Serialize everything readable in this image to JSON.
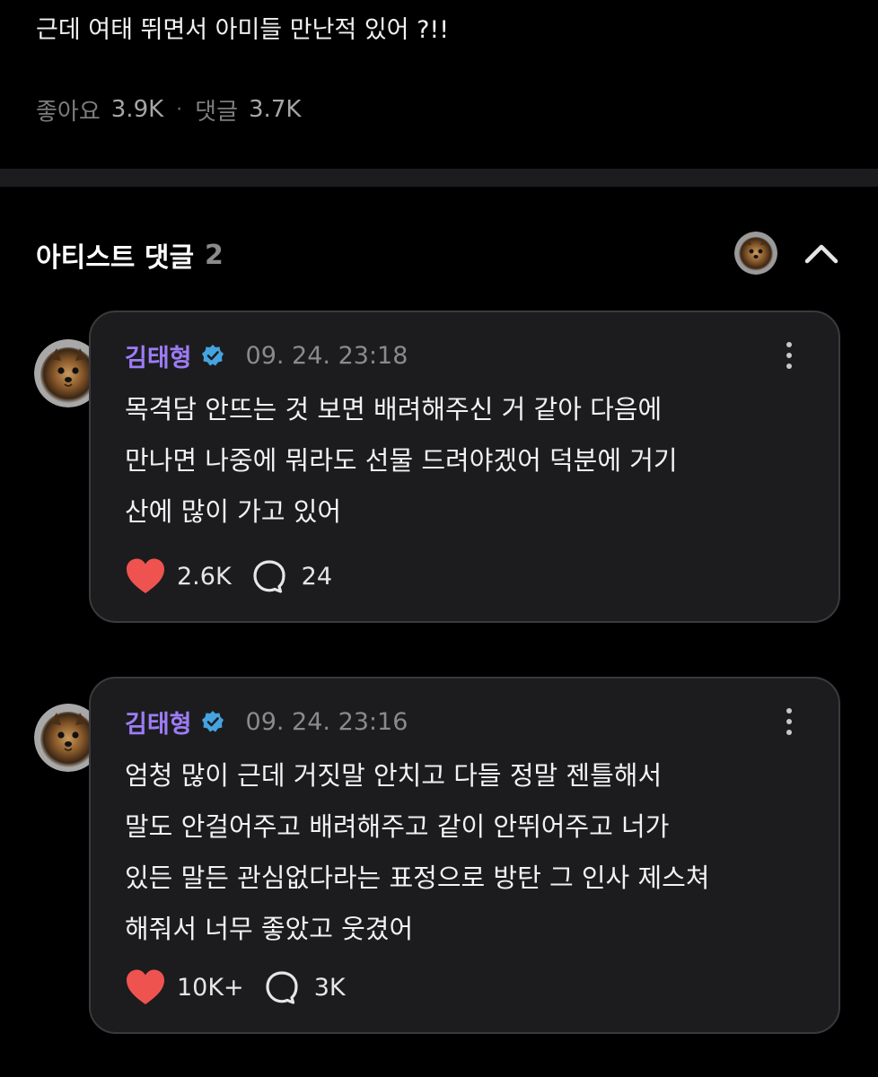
{
  "post": {
    "text": "근데 여태 뛰면서 아미들 만난적 있어 ?!!",
    "likes_label": "좋아요",
    "likes_value": "3.9K",
    "separator": "·",
    "comments_label": "댓글",
    "comments_value": "3.7K"
  },
  "artist_comments": {
    "title": "아티스트 댓글",
    "count": "2"
  },
  "comments": [
    {
      "author": "김태형",
      "timestamp": "09. 24. 23:18",
      "lines": [
        "목격담 안뜨는 것 보면 배려해주신 거 같아 다음에",
        "만나면 나중에 뭐라도 선물 드려야겠어 덕분에 거기",
        "산에 많이 가고 있어"
      ],
      "likes": "2.6K",
      "replies": "24"
    },
    {
      "author": "김태형",
      "timestamp": "09. 24. 23:16",
      "lines": [
        "엄청 많이 근데 거짓말 안치고 다들 정말 젠틀해서",
        "말도 안걸어주고 배려해주고 같이 안뛰어주고 너가",
        "있든 말든 관심없다라는 표정으로 방탄 그 인사 제스쳐",
        "해줘서 너무 좋았고 웃겼어"
      ],
      "likes": "10K+",
      "replies": "3K"
    }
  ],
  "icons": {
    "verified": "verified-badge-icon",
    "more": "more-vertical-icon",
    "heart": "heart-icon",
    "reply": "speech-bubble-icon",
    "collapse": "chevron-up-icon"
  },
  "colors": {
    "background": "#000000",
    "card": "#1c1c1e",
    "card_border": "#3a3a3c",
    "author": "#9d7cf5",
    "verified": "#45a3e0",
    "heart": "#ef5350"
  }
}
